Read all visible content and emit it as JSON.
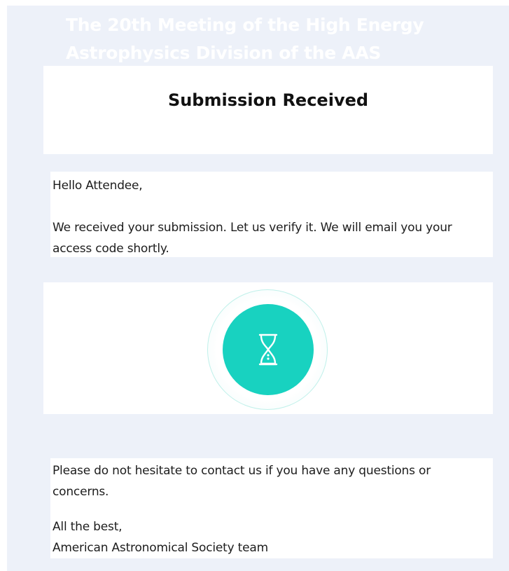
{
  "header": {
    "title": "The 20th Meeting of the High Energy Astrophysics Division of the AAS"
  },
  "status": {
    "heading": "Submission Received"
  },
  "message": {
    "greeting": "Hello Attendee,",
    "body": "We received your submission. Let us verify it. We will email you your access code shortly."
  },
  "icon": {
    "name": "hourglass-icon",
    "accent_color": "#18d2c0"
  },
  "closing": {
    "contact": "Please do not hesitate to contact us if you have any questions or concerns.",
    "sign_off": "All the best,",
    "signature": "American Astronomical Society team"
  }
}
